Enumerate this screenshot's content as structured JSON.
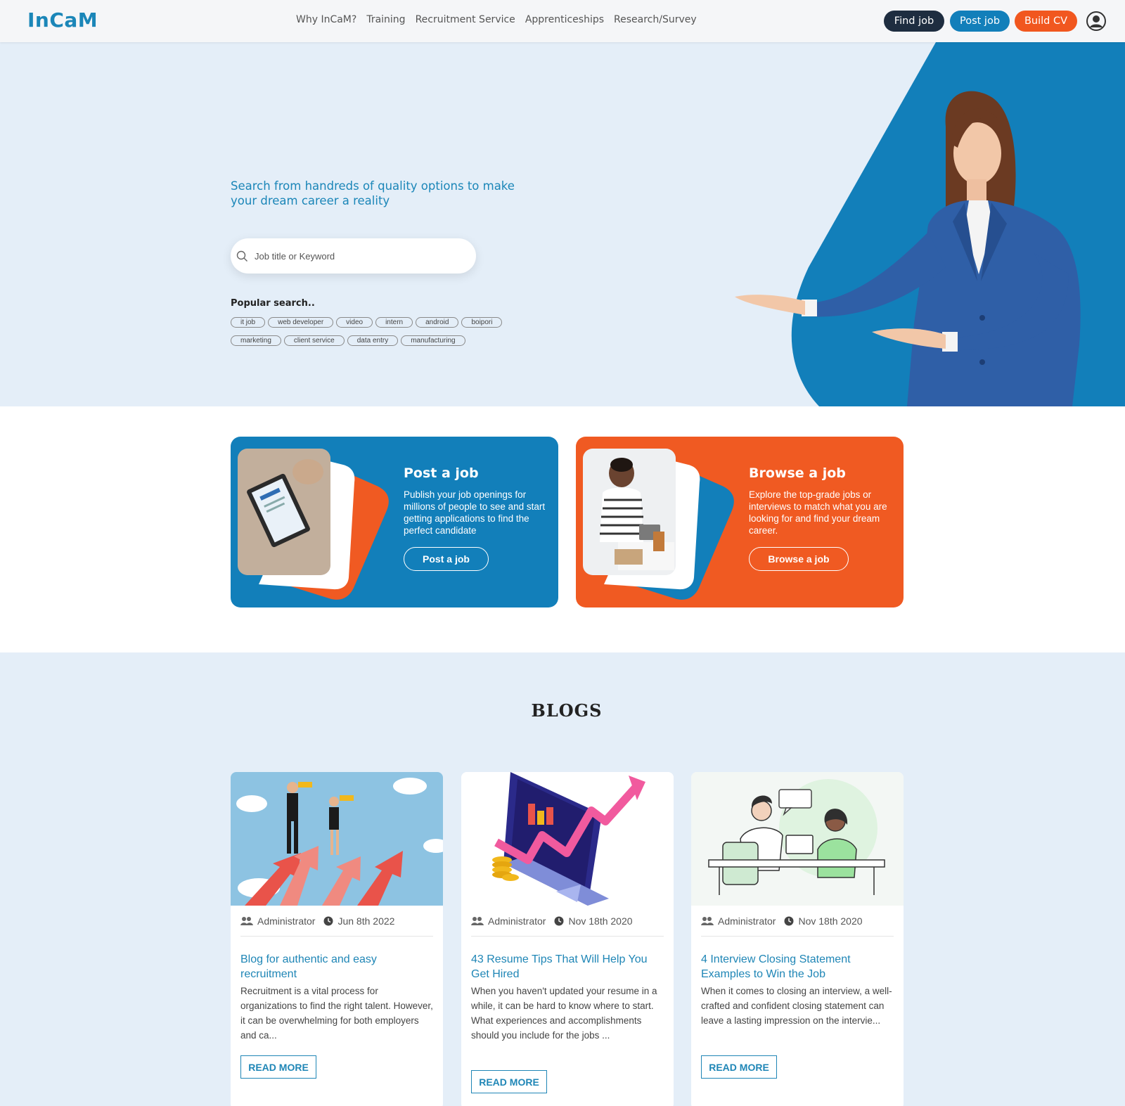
{
  "brand": {
    "logo": "InCaM"
  },
  "nav": {
    "menu": [
      "Why InCaM?",
      "Training",
      "Recruitment Service",
      "Apprenticeships",
      "Research/Survey"
    ],
    "find_job": "Find job",
    "post_job": "Post job",
    "build_cv": "Build CV"
  },
  "hero": {
    "title": "Search from handreds of quality options to make your dream career a reality",
    "search_placeholder": "Job title or Keyword",
    "popular_label": "Popular search..",
    "tags_row1": [
      "it job",
      "web developer",
      "video",
      "intern",
      "android",
      "boipori"
    ],
    "tags_row2": [
      "marketing",
      "client service",
      "data entry",
      "manufacturing"
    ]
  },
  "cards": {
    "post": {
      "title": "Post a job",
      "text": "Publish your job openings for millions of people to see and start getting applications to find the perfect candidate",
      "button": "Post a job"
    },
    "browse": {
      "title": "Browse a job",
      "text": "Explore the top-grade jobs or interviews to match what you are looking for and find your dream career.",
      "button": "Browse a job"
    }
  },
  "blogs": {
    "heading": "BLOGS",
    "items": [
      {
        "author": "Administrator",
        "date": "Jun 8th 2022",
        "title": "Blog for authentic and easy recruitment",
        "excerpt": "Recruitment is a vital process for organizations to find the right talent. However, it can be overwhelming for both employers and ca...",
        "read_more": "READ MORE"
      },
      {
        "author": "Administrator",
        "date": "Nov 18th 2020",
        "title": "43 Resume Tips That Will Help You Get Hired",
        "excerpt": "When you haven't updated your resume in a while, it can be hard to know where to start. What experiences and accomplishments should you include for the jobs ...",
        "read_more": "READ MORE"
      },
      {
        "author": "Administrator",
        "date": "Nov 18th 2020",
        "title": "4 Interview Closing Statement Examples to Win the Job",
        "excerpt": "When it comes to closing an interview, a well-crafted and confident closing statement can leave a lasting impression on the intervie...",
        "read_more": "READ MORE"
      }
    ]
  },
  "colors": {
    "brand_blue": "#127fba",
    "brand_orange": "#f05a22",
    "navy": "#1e2d40",
    "hero_bg": "#e4eef8"
  }
}
